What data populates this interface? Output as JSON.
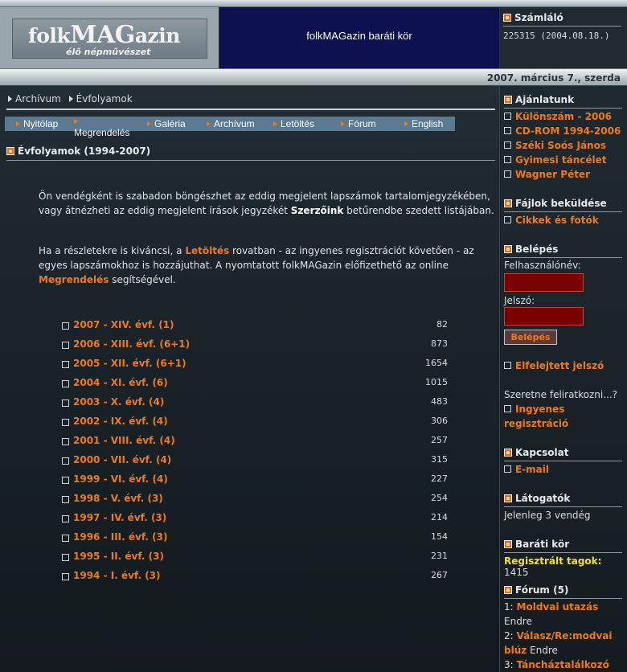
{
  "header": {
    "logo_title_a": "folk",
    "logo_title_b": "MAG",
    "logo_title_c": "azin",
    "logo_subtitle": "élő népművészet",
    "banner": "folkMAGazin baráti kör",
    "counter_title": "Számláló",
    "counter_value": "225315 (2004.08.18.)",
    "date": "2007. március 7., szerda"
  },
  "breadcrumb": [
    "Archívum",
    "Évfolyamok"
  ],
  "nav": [
    "Nyitólap",
    "Megrendelés",
    "Galéria",
    "Archívum",
    "Letöltés",
    "Fórum",
    "English"
  ],
  "main": {
    "section_title": "Évfolyamok (1994-2007)",
    "para1": {
      "a": "Ön vendégként is szabadon böngészhet az eddig megjelent lapszámok tartalomjegyzékében, vagy átnézheti az eddig megjelent írások jegyzékét ",
      "link": "Szerzőink",
      "b": " betűrendbe szedett listájában."
    },
    "para2": {
      "a": "Ha a részletekre is kiváncsi, a ",
      "link1": "Letöltés",
      "b": " rovatban - az ingyenes regisztrációt követően - az egyes lapszámokhoz is hozzájuthat. A nyomtatott folkMAGazin előfizethető az online ",
      "link2": "Megrendelés",
      "c": " segítségével."
    },
    "volumes": [
      {
        "label": "2007 - XIV. évf. (1)",
        "count": "82"
      },
      {
        "label": "2006 - XIII. évf. (6+1)",
        "count": "873"
      },
      {
        "label": "2005 - XII. évf. (6+1)",
        "count": "1654"
      },
      {
        "label": "2004 - XI. évf. (6)",
        "count": "1015"
      },
      {
        "label": "2003 - X. évf. (4)",
        "count": "483"
      },
      {
        "label": "2002 - IX. évf. (4)",
        "count": "306"
      },
      {
        "label": "2001 - VIII. évf. (4)",
        "count": "257"
      },
      {
        "label": "2000 - VII. évf. (4)",
        "count": "315"
      },
      {
        "label": "1999 - VI. évf. (4)",
        "count": "227"
      },
      {
        "label": "1998 - V. évf. (3)",
        "count": "254"
      },
      {
        "label": "1997 - IV. évf. (3)",
        "count": "214"
      },
      {
        "label": "1996 - III. évf. (3)",
        "count": "154"
      },
      {
        "label": "1995 - II. évf. (3)",
        "count": "231"
      },
      {
        "label": "1994 - I. évf. (3)",
        "count": "267"
      }
    ]
  },
  "sidebar": {
    "recommend_title": "Ajánlatunk",
    "recommend": [
      "Különszám - 2006",
      "CD-ROM 1994-2006",
      "Széki Soós János",
      "Gyimesi táncélet",
      "Wagner Péter"
    ],
    "upload_title": "Fájlok beküldése",
    "upload_link": "Cikkek és fotók",
    "login_title": "Belépés",
    "username_label": "Felhasználónév:",
    "password_label": "Jelszó:",
    "login_button": "Belépés",
    "forgot_link": "Elfelejtett jelszó",
    "subscribe_text": "Szeretne feliratkozni...?",
    "register_link_a": "Ingyenes",
    "register_link_b": "regisztráció",
    "contact_title": "Kapcsolat",
    "contact_link": "E-mail",
    "visitors_title": "Látogatók",
    "visitors_text": "Jelenleg 3 vendég",
    "friends_title": "Baráti kör",
    "registered_label": "Regisztrált tagok:",
    "registered_count": "1415",
    "forum_title": "Fórum (5)",
    "forum": [
      {
        "num": "1:",
        "title": "Moldvai utazás",
        "author": "Endre"
      },
      {
        "num": "2:",
        "title_a": "Válasz/Re:modvai",
        "title_b": "blúz",
        "author": "Endre"
      },
      {
        "num": "3:",
        "title": "Táncháztalálkozó"
      }
    ]
  }
}
